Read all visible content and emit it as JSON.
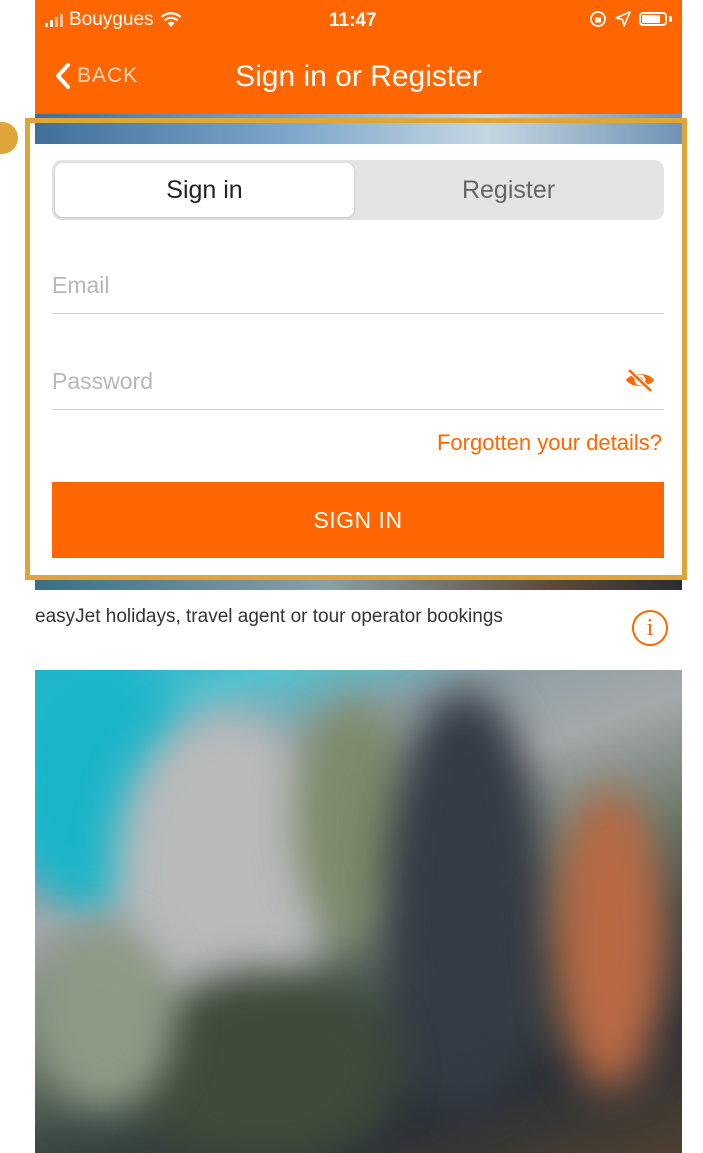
{
  "status_bar": {
    "carrier": "Bouygues",
    "time": "11:47"
  },
  "nav": {
    "back_label": "BACK",
    "title": "Sign in or Register"
  },
  "tabs": {
    "signin_label": "Sign in",
    "register_label": "Register",
    "active": "Sign in"
  },
  "form": {
    "email_placeholder": "Email",
    "password_placeholder": "Password",
    "forgot_label": "Forgotten your details?",
    "submit_label": "SIGN IN"
  },
  "info": {
    "text": "easyJet holidays, travel agent or tour operator bookings",
    "icon_glyph": "i"
  },
  "colors": {
    "brand": "#ff6600",
    "highlight": "#e0a53a"
  },
  "icons": [
    "chevron-left-icon",
    "wifi-icon",
    "location-icon",
    "battery-icon",
    "eye-slash-icon",
    "info-icon"
  ]
}
